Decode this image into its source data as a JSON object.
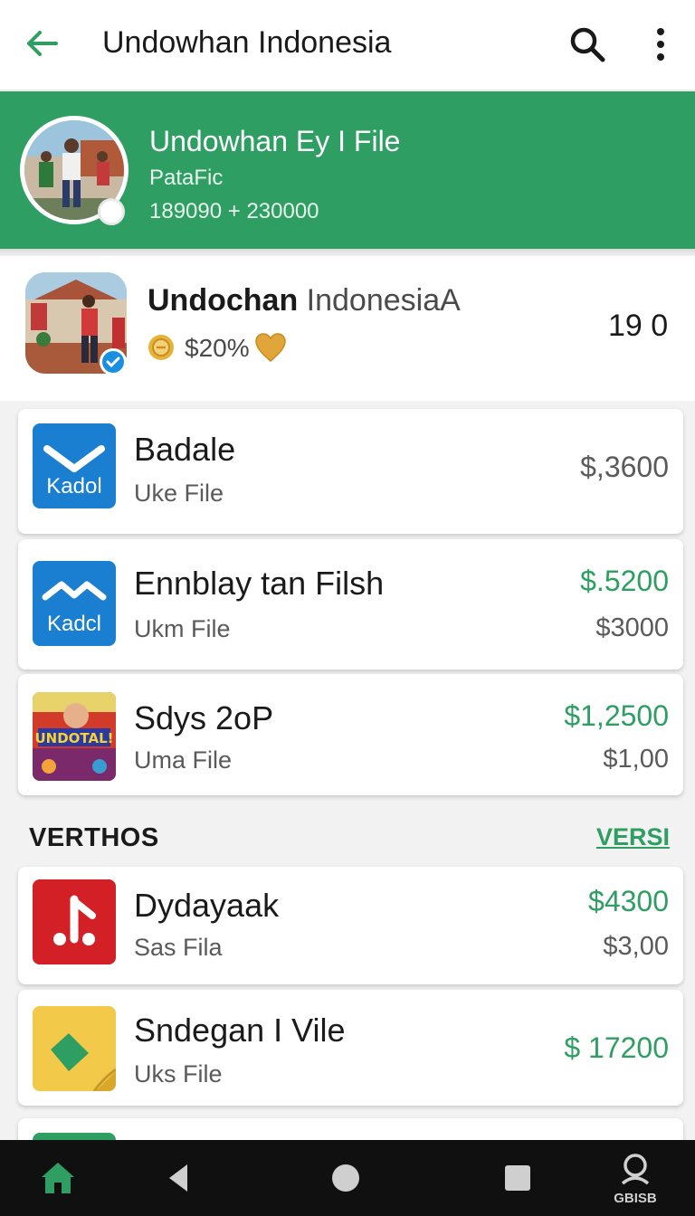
{
  "appbar": {
    "title": "Undowhan Indonesia",
    "icons": [
      "arrow-back-icon",
      "search-icon",
      "more-vert-icon"
    ]
  },
  "profile": {
    "name": "Undowhan Ey I File",
    "subtitle": "PataFic",
    "stats": "189090 + 230000"
  },
  "featured": {
    "name_bold": "Undochan",
    "name_light": " IndonesiaA",
    "percent": "$20%",
    "count": "19 0"
  },
  "cards": [
    {
      "name": "Badale",
      "sub": "Uke File",
      "icon_label": "Kadol",
      "price1": "$,3600",
      "price2": ""
    },
    {
      "name": "Ennblay tan Filsh",
      "sub": "Ukm File",
      "icon_label": "Kadcl",
      "price1": "$.5200",
      "price2": "$3000"
    },
    {
      "name": "Sdys 2oP",
      "sub": "Uma File",
      "icon_label": "UNDOTAL!",
      "price1": "$1,2500",
      "price2": "$1,00"
    }
  ],
  "section": {
    "label": "VERTHOS",
    "link": "VERSI"
  },
  "cards2": [
    {
      "name": "Dydayaak",
      "sub": "Sas Fila",
      "price1": "$4300",
      "price2": "$3,00"
    },
    {
      "name": "Sndegan I Vile",
      "sub": "Uks File",
      "price1": "$ 17200"
    }
  ],
  "navbar": {
    "account_label": "GBISB"
  },
  "colors": {
    "brand_green": "#2e9e63",
    "blue_icon": "#1a7fd0",
    "red_icon": "#d32027",
    "yellow_icon": "#f3c94a"
  }
}
